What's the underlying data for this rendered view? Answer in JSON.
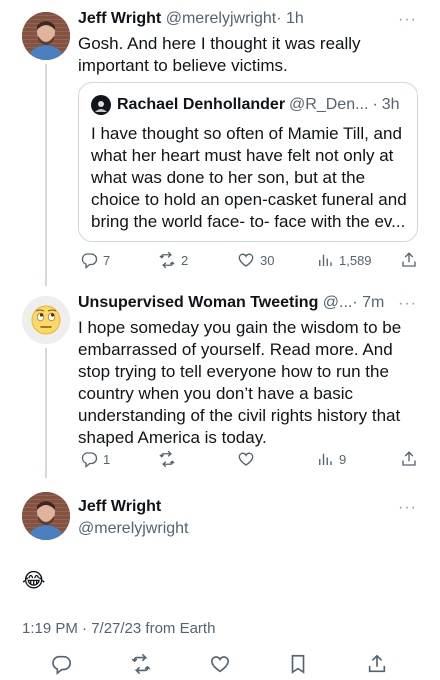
{
  "tweet1": {
    "name": "Jeff Wright",
    "handle": "@merelyjwright",
    "sep": "·",
    "time": "1h",
    "text": "Gosh. And here I thought it was really important to believe victims.",
    "quote": {
      "name": "Rachael Denhollander",
      "handle": "@R_Den...",
      "sep": "·",
      "time": "3h",
      "text": "I have thought so often of Mamie Till, and what her heart must have felt not only at what was done to her son, but at the choice to hold an open-casket funeral and bring the world face- to- face with the ev..."
    },
    "replies": "7",
    "retweets": "2",
    "likes": "30",
    "views": "1,589"
  },
  "tweet2": {
    "name": "Unsupervised Woman Tweeting",
    "handle": "@...",
    "sep": "·",
    "time": "7m",
    "text": "I hope someday you gain the wisdom to be embarrassed of yourself.  Read more.  And stop trying to tell everyone how to run the country when you don’t have a basic understanding of the civil rights history that shaped America is today.",
    "replies": "1",
    "views": "9"
  },
  "main": {
    "name": "Jeff Wright",
    "handle": "@merelyjwright",
    "text": "😂",
    "timestamp": "1:19 PM · 7/27/23 from Earth"
  },
  "more_glyph": "···",
  "colors": {
    "text": "#0f1419",
    "secondary": "#536471",
    "line": "#cfd9de"
  }
}
